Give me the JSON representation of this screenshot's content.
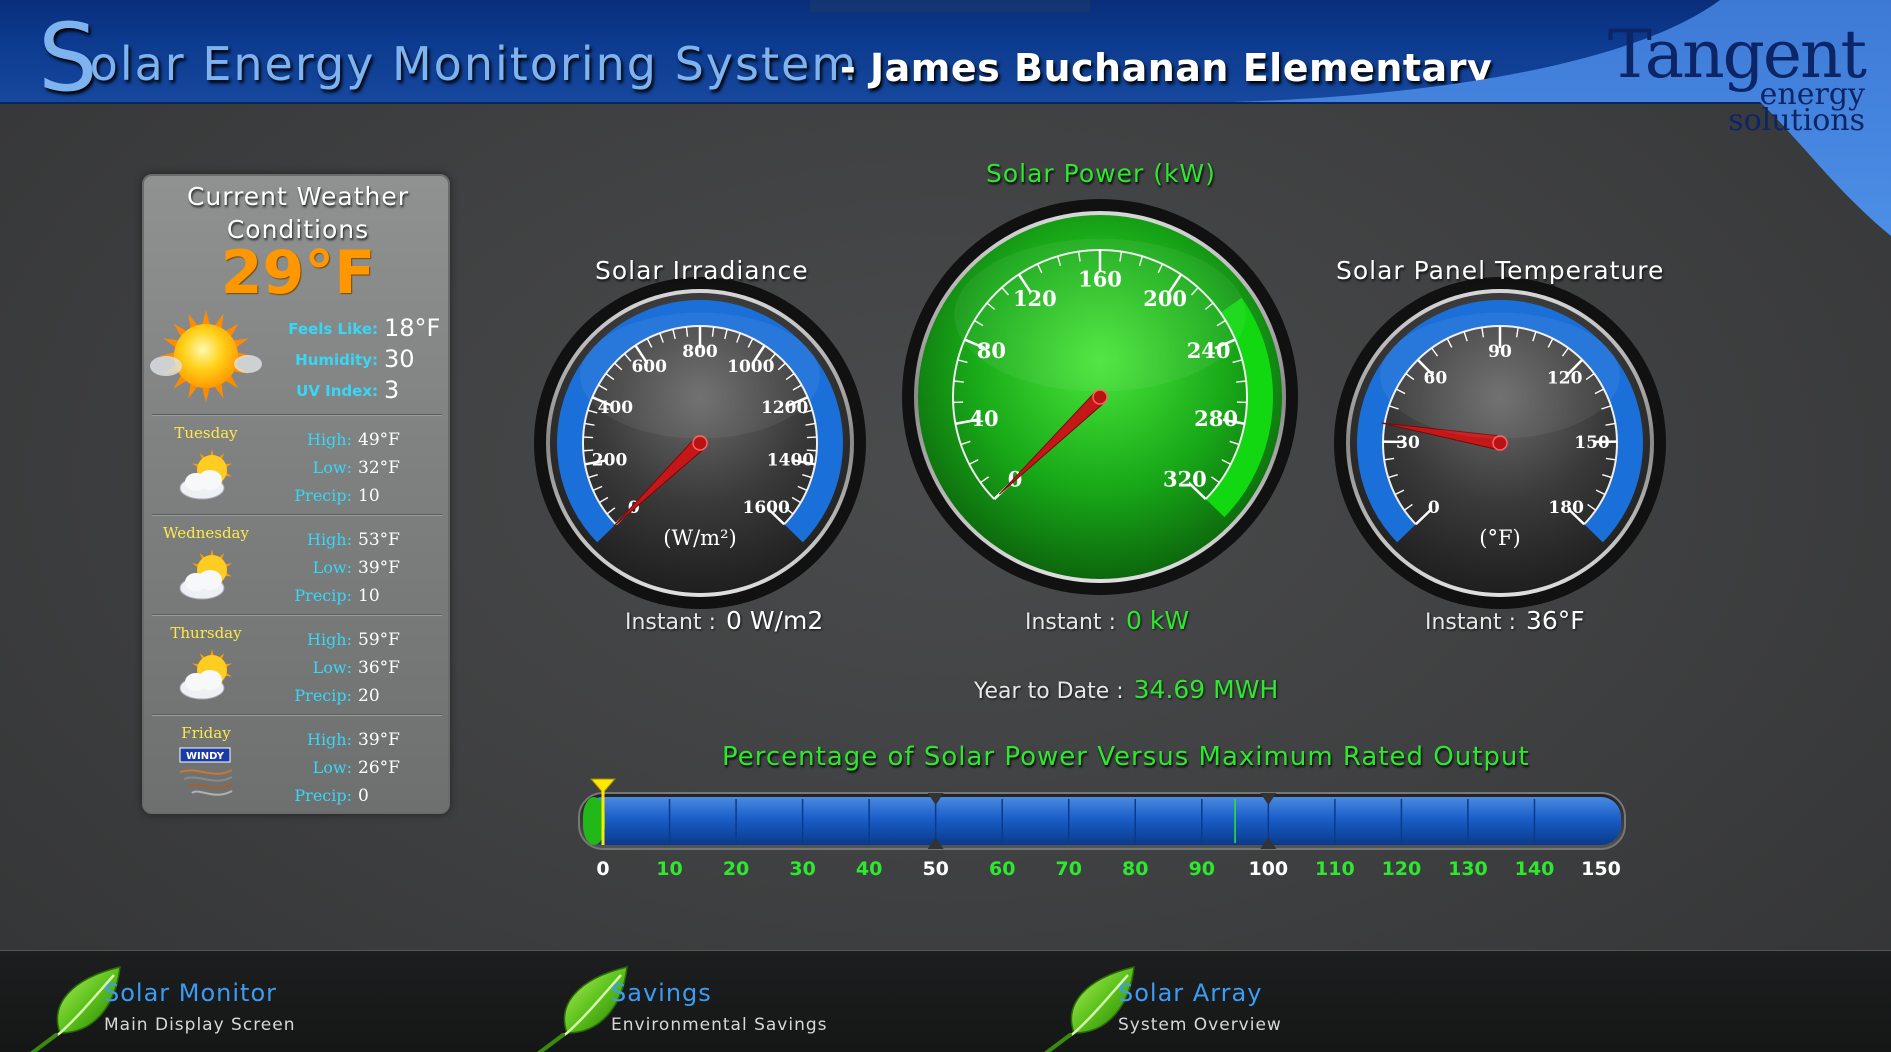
{
  "header": {
    "title_initial": "S",
    "title_rest": "olar Energy Monitoring System",
    "school": "- James Buchanan Elementary",
    "logo_line1": "Tangent",
    "logo_line2": "energy",
    "logo_line3": "solutions"
  },
  "weather": {
    "title": "Current Weather Conditions",
    "temperature": "29°F",
    "feels_like_label": "Feels Like:",
    "feels_like": "18°F",
    "humidity_label": "Humidity:",
    "humidity": "30",
    "uv_label": "UV Index:",
    "uv": "3",
    "current_icon": "sunny-icon",
    "high_label": "High:",
    "low_label": "Low:",
    "precip_label": "Precip:",
    "forecast": [
      {
        "day": "Tuesday",
        "high": "49°F",
        "low": "32°F",
        "precip": "10",
        "icon": "partly-cloudy-icon"
      },
      {
        "day": "Wednesday",
        "high": "53°F",
        "low": "39°F",
        "precip": "10",
        "icon": "partly-cloudy-icon"
      },
      {
        "day": "Thursday",
        "high": "59°F",
        "low": "36°F",
        "precip": "20",
        "icon": "partly-cloudy-icon"
      },
      {
        "day": "Friday",
        "high": "39°F",
        "low": "26°F",
        "precip": "0",
        "icon": "windy-icon",
        "badge": "WINDY"
      }
    ]
  },
  "irradiance": {
    "title": "Solar Irradiance",
    "unit": "(W/m²)",
    "ticks": [
      "0",
      "200",
      "400",
      "600",
      "800",
      "1000",
      "1200",
      "1400",
      "1600"
    ],
    "max": 1600,
    "value": 0,
    "instant_label": "Instant :",
    "instant_value": "0 W/m2"
  },
  "power": {
    "title": "Solar Power (kW)",
    "ticks": [
      "0",
      "40",
      "80",
      "120",
      "160",
      "200",
      "240",
      "280",
      "320"
    ],
    "max": 320,
    "value": 0,
    "instant_label": "Instant :",
    "instant_value": "0 kW",
    "ytd_label": "Year to Date :",
    "ytd_value": "34.69 MWH"
  },
  "temperature": {
    "title": "Solar Panel Temperature",
    "unit": "(°F)",
    "ticks": [
      "0",
      "30",
      "60",
      "90",
      "120",
      "150",
      "180"
    ],
    "max": 180,
    "value": 36,
    "instant_label": "Instant :",
    "instant_value": "36°F"
  },
  "percentage": {
    "title": "Percentage of Solar Power Versus Maximum Rated Output",
    "ticks": [
      "0",
      "10",
      "20",
      "30",
      "40",
      "50",
      "60",
      "70",
      "80",
      "90",
      "100",
      "110",
      "120",
      "130",
      "140",
      "150"
    ],
    "value": 0,
    "max": 150
  },
  "colors": {
    "accent_blue": "#1a6fd6",
    "green": "#2ee82e",
    "orange": "#ff9800",
    "cyan": "#37d7f7"
  },
  "footer": [
    {
      "title": "Solar Monitor",
      "subtitle": "Main Display Screen"
    },
    {
      "title": "Savings",
      "subtitle": "Environmental Savings"
    },
    {
      "title": "Solar Array",
      "subtitle": "System Overview"
    }
  ]
}
